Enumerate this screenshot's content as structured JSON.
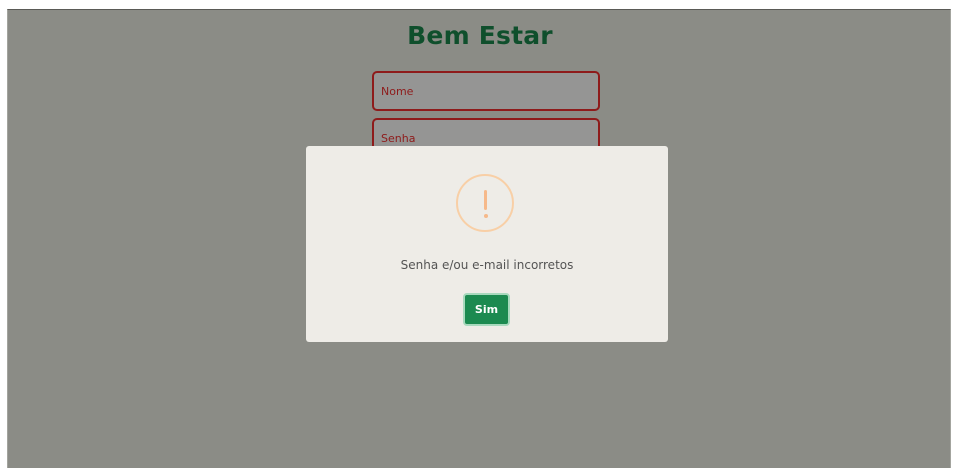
{
  "header": {
    "title": "Bem Estar"
  },
  "form": {
    "name_placeholder": "Nome",
    "password_placeholder": "Senha"
  },
  "dialog": {
    "icon": "exclamation-icon",
    "message": "Senha e/ou e-mail incorretos",
    "confirm_label": "Sim"
  },
  "colors": {
    "title": "#0f4f2c",
    "field_border": "#8e1b1b",
    "overlay": "#8b8c86",
    "dialog_bg": "#eeece7",
    "warning": "#f6b98a",
    "button": "#1c8a50"
  }
}
